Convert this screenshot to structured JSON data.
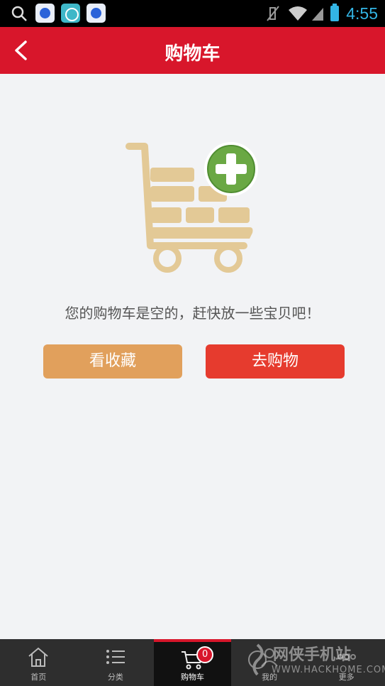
{
  "status_bar": {
    "time": "4:55",
    "icons": [
      "search-icon",
      "baidu-app-icon",
      "app-icon",
      "baidu-app-icon",
      "mute-icon",
      "wifi-icon",
      "signal-icon",
      "battery-icon"
    ]
  },
  "header": {
    "title": "购物车",
    "back_icon": "chevron-left-icon",
    "color": "#d8162b"
  },
  "main": {
    "illustration": "empty-cart-plus-icon",
    "empty_message": "您的购物车是空的，赶快放一些宝贝吧！",
    "buttons": {
      "favorites_label": "看收藏",
      "shop_label": "去购物"
    }
  },
  "bottom_nav": {
    "items": [
      {
        "label": "首页",
        "icon": "home-icon"
      },
      {
        "label": "分类",
        "icon": "list-icon"
      },
      {
        "label": "购物车",
        "icon": "cart-icon",
        "badge": "0",
        "active": true
      },
      {
        "label": "我的",
        "icon": "user-icon"
      },
      {
        "label": "更多",
        "icon": "more-icon"
      }
    ]
  },
  "watermark": {
    "title": "网侠手机站",
    "url": "WWW.HACKHOME.COM"
  },
  "colors": {
    "accent": "#d8162b",
    "favorites_button": "#e1a05c",
    "shop_button": "#e63b2e",
    "status_accent": "#33b5e5"
  }
}
